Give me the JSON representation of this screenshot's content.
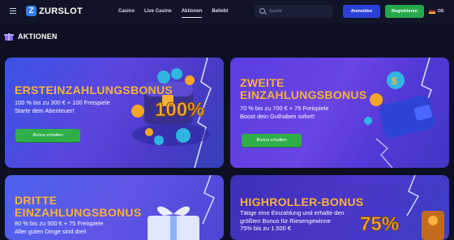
{
  "header": {
    "logo_letter": "Z",
    "logo_text": "ZURSLOT",
    "nav": [
      "Casino",
      "Live Casino",
      "Aktionen",
      "Beliebt"
    ],
    "search_placeholder": "Suche",
    "login_label": "Anmelden",
    "register_label": "Registrieren",
    "language": "DE"
  },
  "section": {
    "title": "AKTIONEN",
    "icon": "gift-icon"
  },
  "colors": {
    "accent_gold": "#f7b23b",
    "primary_blue": "#2b3fd8",
    "primary_green": "#25a84b"
  },
  "promos": [
    {
      "title_lines": [
        "ERSTEINZAHLUNGSBONUS"
      ],
      "text_lines": [
        "100 % bis zu 300 € + 100 Freispiele",
        "Starte dein Abenteuer!"
      ],
      "button_label": "Bonus erhalten",
      "art_text": "100%"
    },
    {
      "title_lines": [
        "ZWEITE",
        "EINZAHLUNGSBONUS"
      ],
      "text_lines": [
        "70 % bis zu 700 € + 75 Freispiele",
        "Boost dein Guthaben sofort!"
      ],
      "button_label": "Bonus erhalten"
    },
    {
      "title_lines": [
        "DRITTE",
        "EINZAHLUNGSBONUS"
      ],
      "text_lines": [
        "80 % bis zu 500 € + 75 Freispiele",
        "Aller guten Dinge sind drei!"
      ]
    },
    {
      "title_lines": [
        "HIGHROLLER-BONUS"
      ],
      "text_lines": [
        "Tätige eine Einzahlung und erhalte den",
        "größten Bonus für Riesengewinne",
        "75% bis zu 1.500 €"
      ],
      "art_text": "75%"
    }
  ]
}
